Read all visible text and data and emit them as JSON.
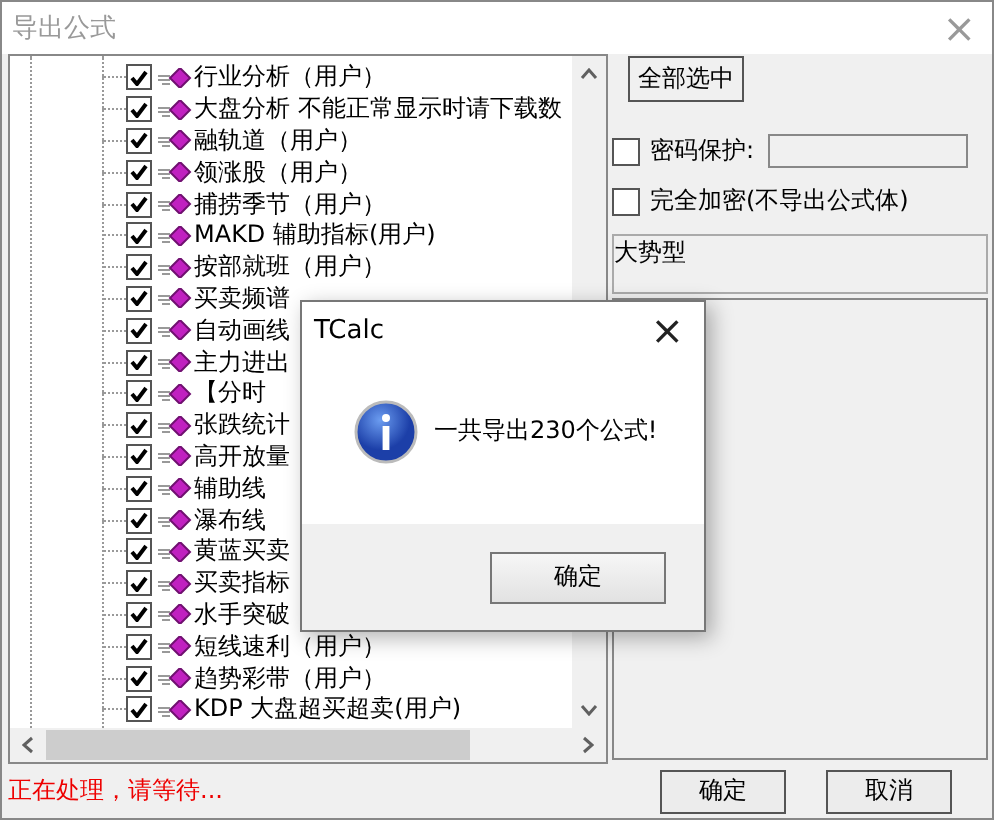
{
  "window": {
    "title": "导出公式",
    "close": "×"
  },
  "tree": {
    "items": [
      {
        "label": "行业分析（用户）",
        "checked": true
      },
      {
        "label": "大盘分析 不能正常显示时请下载数",
        "checked": true
      },
      {
        "label": "融轨道（用户）",
        "checked": true
      },
      {
        "label": "领涨股（用户）",
        "checked": true
      },
      {
        "label": "捕捞季节（用户）",
        "checked": true
      },
      {
        "label": "MAKD 辅助指标(用户)",
        "checked": true
      },
      {
        "label": "按部就班（用户）",
        "checked": true
      },
      {
        "label": "买卖频谱",
        "checked": true
      },
      {
        "label": "自动画线",
        "checked": true
      },
      {
        "label": "主力进出",
        "checked": true
      },
      {
        "label": "【分时",
        "checked": true
      },
      {
        "label": "张跌统计",
        "checked": true
      },
      {
        "label": "高开放量",
        "checked": true
      },
      {
        "label": "辅助线",
        "checked": true
      },
      {
        "label": "瀑布线",
        "checked": true
      },
      {
        "label": "黄蓝买卖",
        "checked": true
      },
      {
        "label": "买卖指标",
        "checked": true
      },
      {
        "label": "水手突破",
        "checked": true
      },
      {
        "label": "短线速利（用户）",
        "checked": true
      },
      {
        "label": "趋势彩带（用户）",
        "checked": true
      },
      {
        "label": "KDP 大盘超买超卖(用户)",
        "checked": true
      }
    ]
  },
  "select_all_button": "全部选中",
  "options": [
    {
      "label": "密码保护:",
      "checked": false,
      "kind": "field"
    },
    {
      "label": "完全加密(不导出公式体)",
      "checked": false,
      "kind": "plain"
    }
  ],
  "description": "大势型",
  "status": "正在处理，请等待...",
  "buttons": [
    "确定",
    "取消"
  ],
  "dialog": {
    "title": "TCalc",
    "close": "×",
    "message": "一共导出230个公式!",
    "button": "确定"
  }
}
